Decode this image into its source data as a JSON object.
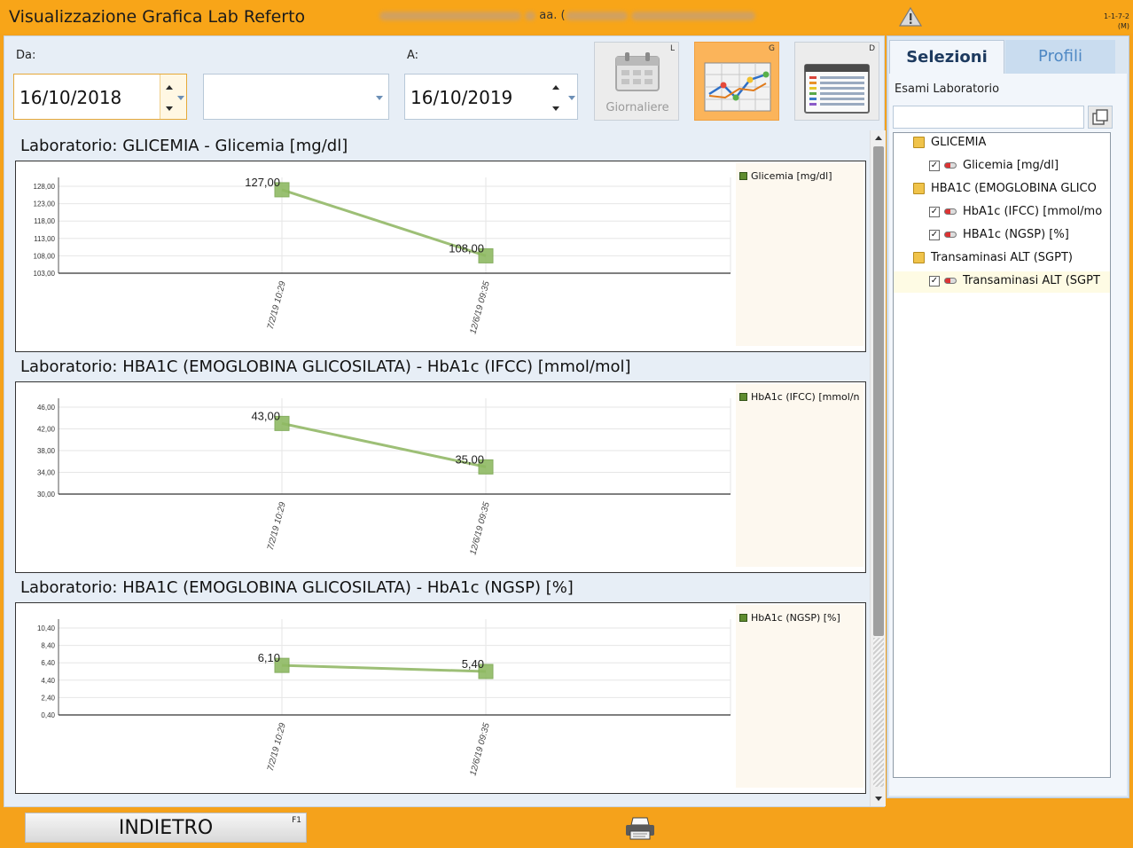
{
  "title": {
    "app_title": "Visualizzazione Grafica Lab Referto",
    "patient_age_prefix": "aa. (",
    "version_line1": "1-1-7-2",
    "version_line2": "(M)"
  },
  "toolbar": {
    "from_label": "Da:",
    "from_value": "16/10/2018",
    "to_label": "A:",
    "to_value": "16/10/2019",
    "view_daily_label": "Giornaliere",
    "view_daily_key": "L",
    "view_graph_key": "G",
    "view_table_key": "D"
  },
  "charts": [
    {
      "title": "Laboratorio: GLICEMIA - Glicemia [mg/dl]",
      "legend": "Glicemia [mg/dl]",
      "y_ticks": [
        "128,00",
        "123,00",
        "118,00",
        "113,00",
        "108,00",
        "103,00"
      ],
      "point_labels": [
        "127,00",
        "108,00"
      ],
      "x_ticks": [
        "7/2/19 10:29",
        "12/6/19 09:35"
      ]
    },
    {
      "title": "Laboratorio: HBA1C (EMOGLOBINA GLICOSILATA) - HbA1c (IFCC) [mmol/mol]",
      "legend": "HbA1c (IFCC) [mmol/n",
      "y_ticks": [
        "46,00",
        "42,00",
        "38,00",
        "34,00",
        "30,00"
      ],
      "point_labels": [
        "43,00",
        "35,00"
      ],
      "x_ticks": [
        "7/2/19 10:29",
        "12/6/19 09:35"
      ]
    },
    {
      "title": "Laboratorio: HBA1C (EMOGLOBINA GLICOSILATA) - HbA1c (NGSP) [%]",
      "legend": "HbA1c (NGSP) [%]",
      "y_ticks": [
        "10,40",
        "8,40",
        "6,40",
        "4,40",
        "2,40",
        "0,40"
      ],
      "point_labels": [
        "6,10",
        "5,40"
      ],
      "x_ticks": [
        "7/2/19 10:29",
        "12/6/19 09:35"
      ]
    }
  ],
  "chart_data": [
    {
      "type": "line",
      "title": "Laboratorio: GLICEMIA - Glicemia [mg/dl]",
      "x": [
        "7/2/19 10:29",
        "12/6/19 09:35"
      ],
      "series": [
        {
          "name": "Glicemia [mg/dl]",
          "values": [
            127,
            108
          ]
        }
      ],
      "ylim": [
        103,
        128
      ],
      "grid": true,
      "legend": "top-right",
      "color": "#9dbf76"
    },
    {
      "type": "line",
      "title": "Laboratorio: HBA1C (EMOGLOBINA GLICOSILATA) - HbA1c (IFCC) [mmol/mol]",
      "x": [
        "7/2/19 10:29",
        "12/6/19 09:35"
      ],
      "series": [
        {
          "name": "HbA1c (IFCC) [mmol/n",
          "values": [
            43,
            35
          ]
        }
      ],
      "ylim": [
        30,
        46
      ],
      "grid": true,
      "legend": "top-right",
      "color": "#9dbf76"
    },
    {
      "type": "line",
      "title": "Laboratorio: HBA1C (EMOGLOBINA GLICOSILATA) - HbA1c (NGSP) [%]",
      "x": [
        "7/2/19 10:29",
        "12/6/19 09:35"
      ],
      "series": [
        {
          "name": "HbA1c (NGSP) [%]",
          "values": [
            6.1,
            5.4
          ]
        }
      ],
      "ylim": [
        0.4,
        10.4
      ],
      "grid": true,
      "legend": "top-right",
      "color": "#9dbf76"
    }
  ],
  "sidebar": {
    "tab_selections": "Selezioni",
    "tab_profiles": "Profili",
    "exams_label": "Esami Laboratorio",
    "tree": [
      {
        "kind": "folder",
        "label": "GLICEMIA"
      },
      {
        "kind": "item",
        "label": "Glicemia [mg/dl]",
        "checked": true
      },
      {
        "kind": "folder",
        "label": "HBA1C (EMOGLOBINA GLICO"
      },
      {
        "kind": "item",
        "label": "HbA1c (IFCC) [mmol/mo",
        "checked": true
      },
      {
        "kind": "item",
        "label": "HBA1c (NGSP) [%]",
        "checked": true
      },
      {
        "kind": "folder",
        "label": "Transaminasi ALT (SGPT)"
      },
      {
        "kind": "item",
        "label": "Transaminasi ALT (SGPT",
        "checked": true,
        "selected": true
      }
    ]
  },
  "footer": {
    "back_label": "INDIETRO",
    "back_key": "F1"
  },
  "colors": {
    "accent": "#f8a518",
    "line": "#9dbf76",
    "marker": "#8fba63"
  }
}
